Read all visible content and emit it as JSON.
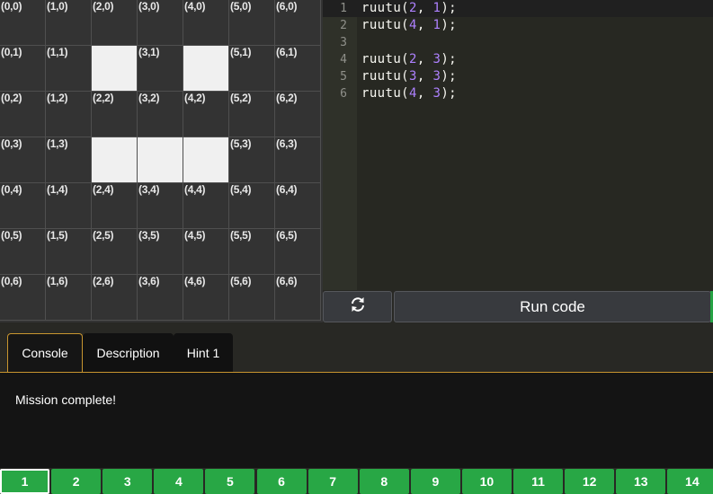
{
  "grid": {
    "columns": 7,
    "rows": 7,
    "filled": [
      [
        2,
        1
      ],
      [
        4,
        1
      ],
      [
        2,
        3
      ],
      [
        3,
        3
      ],
      [
        4,
        3
      ]
    ],
    "colors": {
      "empty": "#333333",
      "filled": "#f0f0f0",
      "line": "#4f4f4f"
    }
  },
  "editor": {
    "lines": [
      {
        "num": "1",
        "tokens": [
          {
            "t": "ruutu("
          },
          {
            "t": "2",
            "n": true
          },
          {
            "t": ", "
          },
          {
            "t": "1",
            "n": true
          },
          {
            "t": ");"
          }
        ],
        "active": true
      },
      {
        "num": "2",
        "tokens": [
          {
            "t": "ruutu("
          },
          {
            "t": "4",
            "n": true
          },
          {
            "t": ", "
          },
          {
            "t": "1",
            "n": true
          },
          {
            "t": ");"
          }
        ]
      },
      {
        "num": "3",
        "tokens": []
      },
      {
        "num": "4",
        "tokens": [
          {
            "t": "ruutu("
          },
          {
            "t": "2",
            "n": true
          },
          {
            "t": ", "
          },
          {
            "t": "3",
            "n": true
          },
          {
            "t": ");"
          }
        ]
      },
      {
        "num": "5",
        "tokens": [
          {
            "t": "ruutu("
          },
          {
            "t": "3",
            "n": true
          },
          {
            "t": ", "
          },
          {
            "t": "3",
            "n": true
          },
          {
            "t": ");"
          }
        ]
      },
      {
        "num": "6",
        "tokens": [
          {
            "t": "ruutu("
          },
          {
            "t": "4",
            "n": true
          },
          {
            "t": ", "
          },
          {
            "t": "3",
            "n": true
          },
          {
            "t": ");"
          }
        ]
      }
    ]
  },
  "controls": {
    "reset_icon": "refresh-icon",
    "run_label": "Run code"
  },
  "tabs": [
    {
      "label": "Console",
      "active": true
    },
    {
      "label": "Description"
    },
    {
      "label": "Hint 1"
    }
  ],
  "console": {
    "text": "Mission complete!"
  },
  "levels": {
    "current": "1",
    "items": [
      "1",
      "2",
      "3",
      "4",
      "5",
      "6",
      "7",
      "8",
      "9",
      "10",
      "11",
      "12",
      "13",
      "14"
    ],
    "color": "#28a745"
  }
}
